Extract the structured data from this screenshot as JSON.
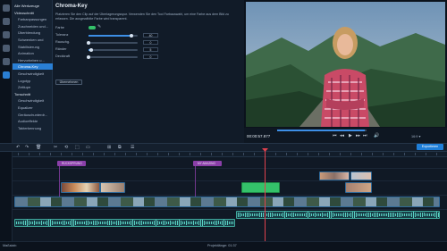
{
  "rail": {
    "icons": [
      "import-icon",
      "effects-icon",
      "filters-icon",
      "transitions-icon",
      "stickers-icon",
      "more-tools-icon"
    ]
  },
  "tools": {
    "items": [
      {
        "label": "Alle Werkzeuge",
        "kind": "grp"
      },
      {
        "label": "Videoschnitt",
        "kind": "grp"
      },
      {
        "label": "Farbanpassungen",
        "kind": "sub"
      },
      {
        "label": "Zuschneiden und...",
        "kind": "sub"
      },
      {
        "label": "Überblendung",
        "kind": "sub"
      },
      {
        "label": "Schwenken und",
        "kind": "sub"
      },
      {
        "label": "Stabilisierung",
        "kind": "sub"
      },
      {
        "label": "Animation",
        "kind": "sub"
      },
      {
        "label": "Hervorheben u...",
        "kind": "sub"
      },
      {
        "label": "Chroma-Key",
        "kind": "sub",
        "active": true
      },
      {
        "label": "Geschwindigkeit",
        "kind": "sub"
      },
      {
        "label": "Logotyp",
        "kind": "sub"
      },
      {
        "label": "Zeitlupe",
        "kind": "sub"
      },
      {
        "label": "Tonschnitt",
        "kind": "grp"
      },
      {
        "label": "Geschwindigkeit",
        "kind": "sub"
      },
      {
        "label": "Equalizer",
        "kind": "sub"
      },
      {
        "label": "Geräuschunterdr...",
        "kind": "sub"
      },
      {
        "label": "Audioeffekte",
        "kind": "sub"
      },
      {
        "label": "Takterkennung",
        "kind": "sub"
      }
    ]
  },
  "panel": {
    "title": "Chroma-Key",
    "description": "Platzieren Sie den Clip auf der Überlagerungsspur. Verwenden Sie den Tool Farbauswahl, um eine Farbe aus dem Bild zu erfassen. Die ausgewählte Farbe wird transparent.",
    "color_label": "Farbe",
    "key_color": "#34c26a",
    "sliders": [
      {
        "label": "Toleranz",
        "value": "40",
        "fraction": 0.88
      },
      {
        "label": "Rauschg.",
        "value": "0",
        "fraction": 0.0
      },
      {
        "label": "Ränder",
        "value": "5",
        "fraction": 0.05
      },
      {
        "label": "Deckkraft",
        "value": "0",
        "fraction": 0.0
      }
    ],
    "reset_label": "Übernehmen"
  },
  "preview": {
    "time": "00:00:57.877",
    "zoom_label": "16:9 ▾",
    "controls": [
      "⏮",
      "◂◂",
      "▶",
      "▸▸",
      "⏭",
      "🔊"
    ]
  },
  "toolbar": {
    "buttons": [
      "↶",
      "↷",
      "🗑",
      "✂",
      "⟲",
      "⬚",
      "▭",
      "⊞",
      "⧉",
      "☰"
    ],
    "export_label": "Exportieren"
  },
  "timeline": {
    "markers": [
      "RÜCKSPRUNG",
      "MY AMAZING"
    ],
    "track_icons": [
      "lock-icon",
      "lock-icon",
      "lock-icon",
      "lock-icon",
      "lock-icon"
    ]
  },
  "status": {
    "left": "Maßstab:",
    "middle": "Projektlänge: 01:37"
  },
  "colors": {
    "accent": "#2a7fd4",
    "marker": "#8a3fa8",
    "playhead": "#e0424e",
    "audio": "#59cfc2"
  }
}
